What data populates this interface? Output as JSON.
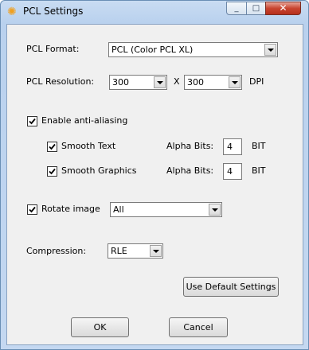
{
  "window": {
    "title": "PCL Settings",
    "icon": "gear-icon",
    "minimize": "_",
    "maximize": "□",
    "close": "✕"
  },
  "format": {
    "label": "PCL Format:",
    "value": "PCL (Color PCL XL)"
  },
  "resolution": {
    "label": "PCL Resolution:",
    "x_value": "300",
    "separator": "X",
    "y_value": "300",
    "unit": "DPI"
  },
  "antialias": {
    "label": "Enable anti-aliasing",
    "checked": true,
    "smooth_text": {
      "label": "Smooth Text",
      "checked": true,
      "alpha_label": "Alpha Bits:",
      "alpha_value": "4",
      "unit": "BIT"
    },
    "smooth_graphics": {
      "label": "Smooth Graphics",
      "checked": true,
      "alpha_label": "Alpha Bits:",
      "alpha_value": "4",
      "unit": "BIT"
    }
  },
  "rotate": {
    "label": "Rotate image",
    "checked": true,
    "value": "All"
  },
  "compression": {
    "label": "Compression:",
    "value": "RLE"
  },
  "buttons": {
    "defaults": "Use Default Settings",
    "ok": "OK",
    "cancel": "Cancel"
  }
}
